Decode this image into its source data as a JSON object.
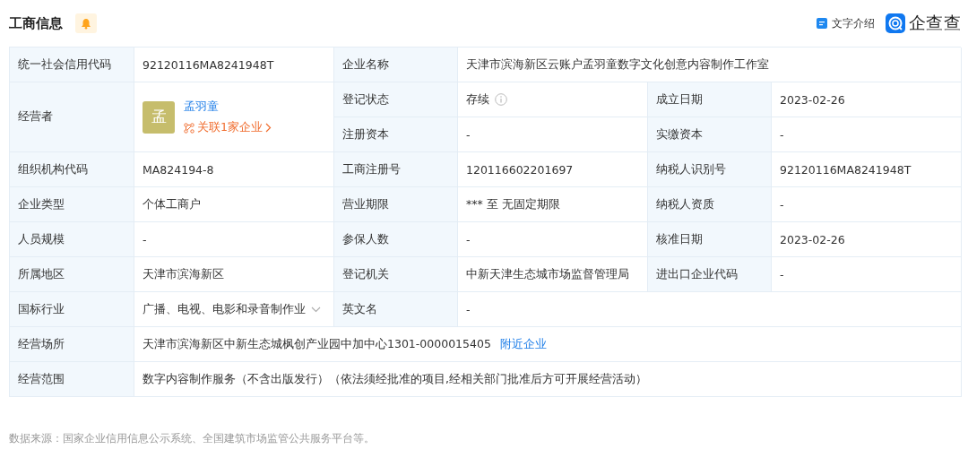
{
  "header": {
    "title": "工商信息",
    "text_intro": "文字介绍",
    "logo": "企查查"
  },
  "rows": [
    {
      "kind": "fields",
      "fields": [
        {
          "label": "统一社会信用代码",
          "value": "92120116MA8241948T"
        },
        {
          "label": "企业名称",
          "value": "天津市滨海新区云账户孟羽童数字文化创意内容制作工作室"
        }
      ]
    },
    {
      "kind": "operator",
      "label": "经营者",
      "person": {
        "avatar": "孟",
        "name": "孟羽童",
        "related": "关联1家企业"
      },
      "sub_rows": [
        [
          {
            "label": "登记状态",
            "value": "存续",
            "info": true
          },
          {
            "label": "成立日期",
            "value": "2023-02-26"
          }
        ],
        [
          {
            "label": "注册资本",
            "value": "-"
          },
          {
            "label": "实缴资本",
            "value": "-"
          }
        ]
      ]
    },
    {
      "kind": "fields",
      "fields": [
        {
          "label": "组织机构代码",
          "value": "MA824194-8"
        },
        {
          "label": "工商注册号",
          "value": "120116602201697"
        },
        {
          "label": "纳税人识别号",
          "value": "92120116MA8241948T"
        }
      ]
    },
    {
      "kind": "fields",
      "fields": [
        {
          "label": "企业类型",
          "value": "个体工商户"
        },
        {
          "label": "营业期限",
          "value": "*** 至 无固定期限"
        },
        {
          "label": "纳税人资质",
          "value": "-"
        }
      ]
    },
    {
      "kind": "fields",
      "fields": [
        {
          "label": "人员规模",
          "value": "-"
        },
        {
          "label": "参保人数",
          "value": "-"
        },
        {
          "label": "核准日期",
          "value": "2023-02-26"
        }
      ]
    },
    {
      "kind": "fields",
      "fields": [
        {
          "label": "所属地区",
          "value": "天津市滨海新区"
        },
        {
          "label": "登记机关",
          "value": "中新天津生态城市场监督管理局"
        },
        {
          "label": "进出口企业代码",
          "value": "-"
        }
      ]
    },
    {
      "kind": "fields",
      "fields": [
        {
          "label": "国标行业",
          "value": "广播、电视、电影和录音制作业",
          "expandable": true
        },
        {
          "label": "英文名",
          "value": "-"
        }
      ]
    },
    {
      "kind": "fields",
      "fields": [
        {
          "label": "经营场所",
          "value": "天津市滨海新区中新生态城枫创产业园中加中心1301-0000015405",
          "link": "附近企业"
        }
      ]
    },
    {
      "kind": "fields",
      "fields": [
        {
          "label": "经营范围",
          "value": "数字内容制作服务（不含出版发行）（依法须经批准的项目,经相关部门批准后方可开展经营活动）"
        }
      ]
    }
  ],
  "footer": "数据来源：国家企业信用信息公示系统、全国建筑市场监管公共服务平台等。"
}
